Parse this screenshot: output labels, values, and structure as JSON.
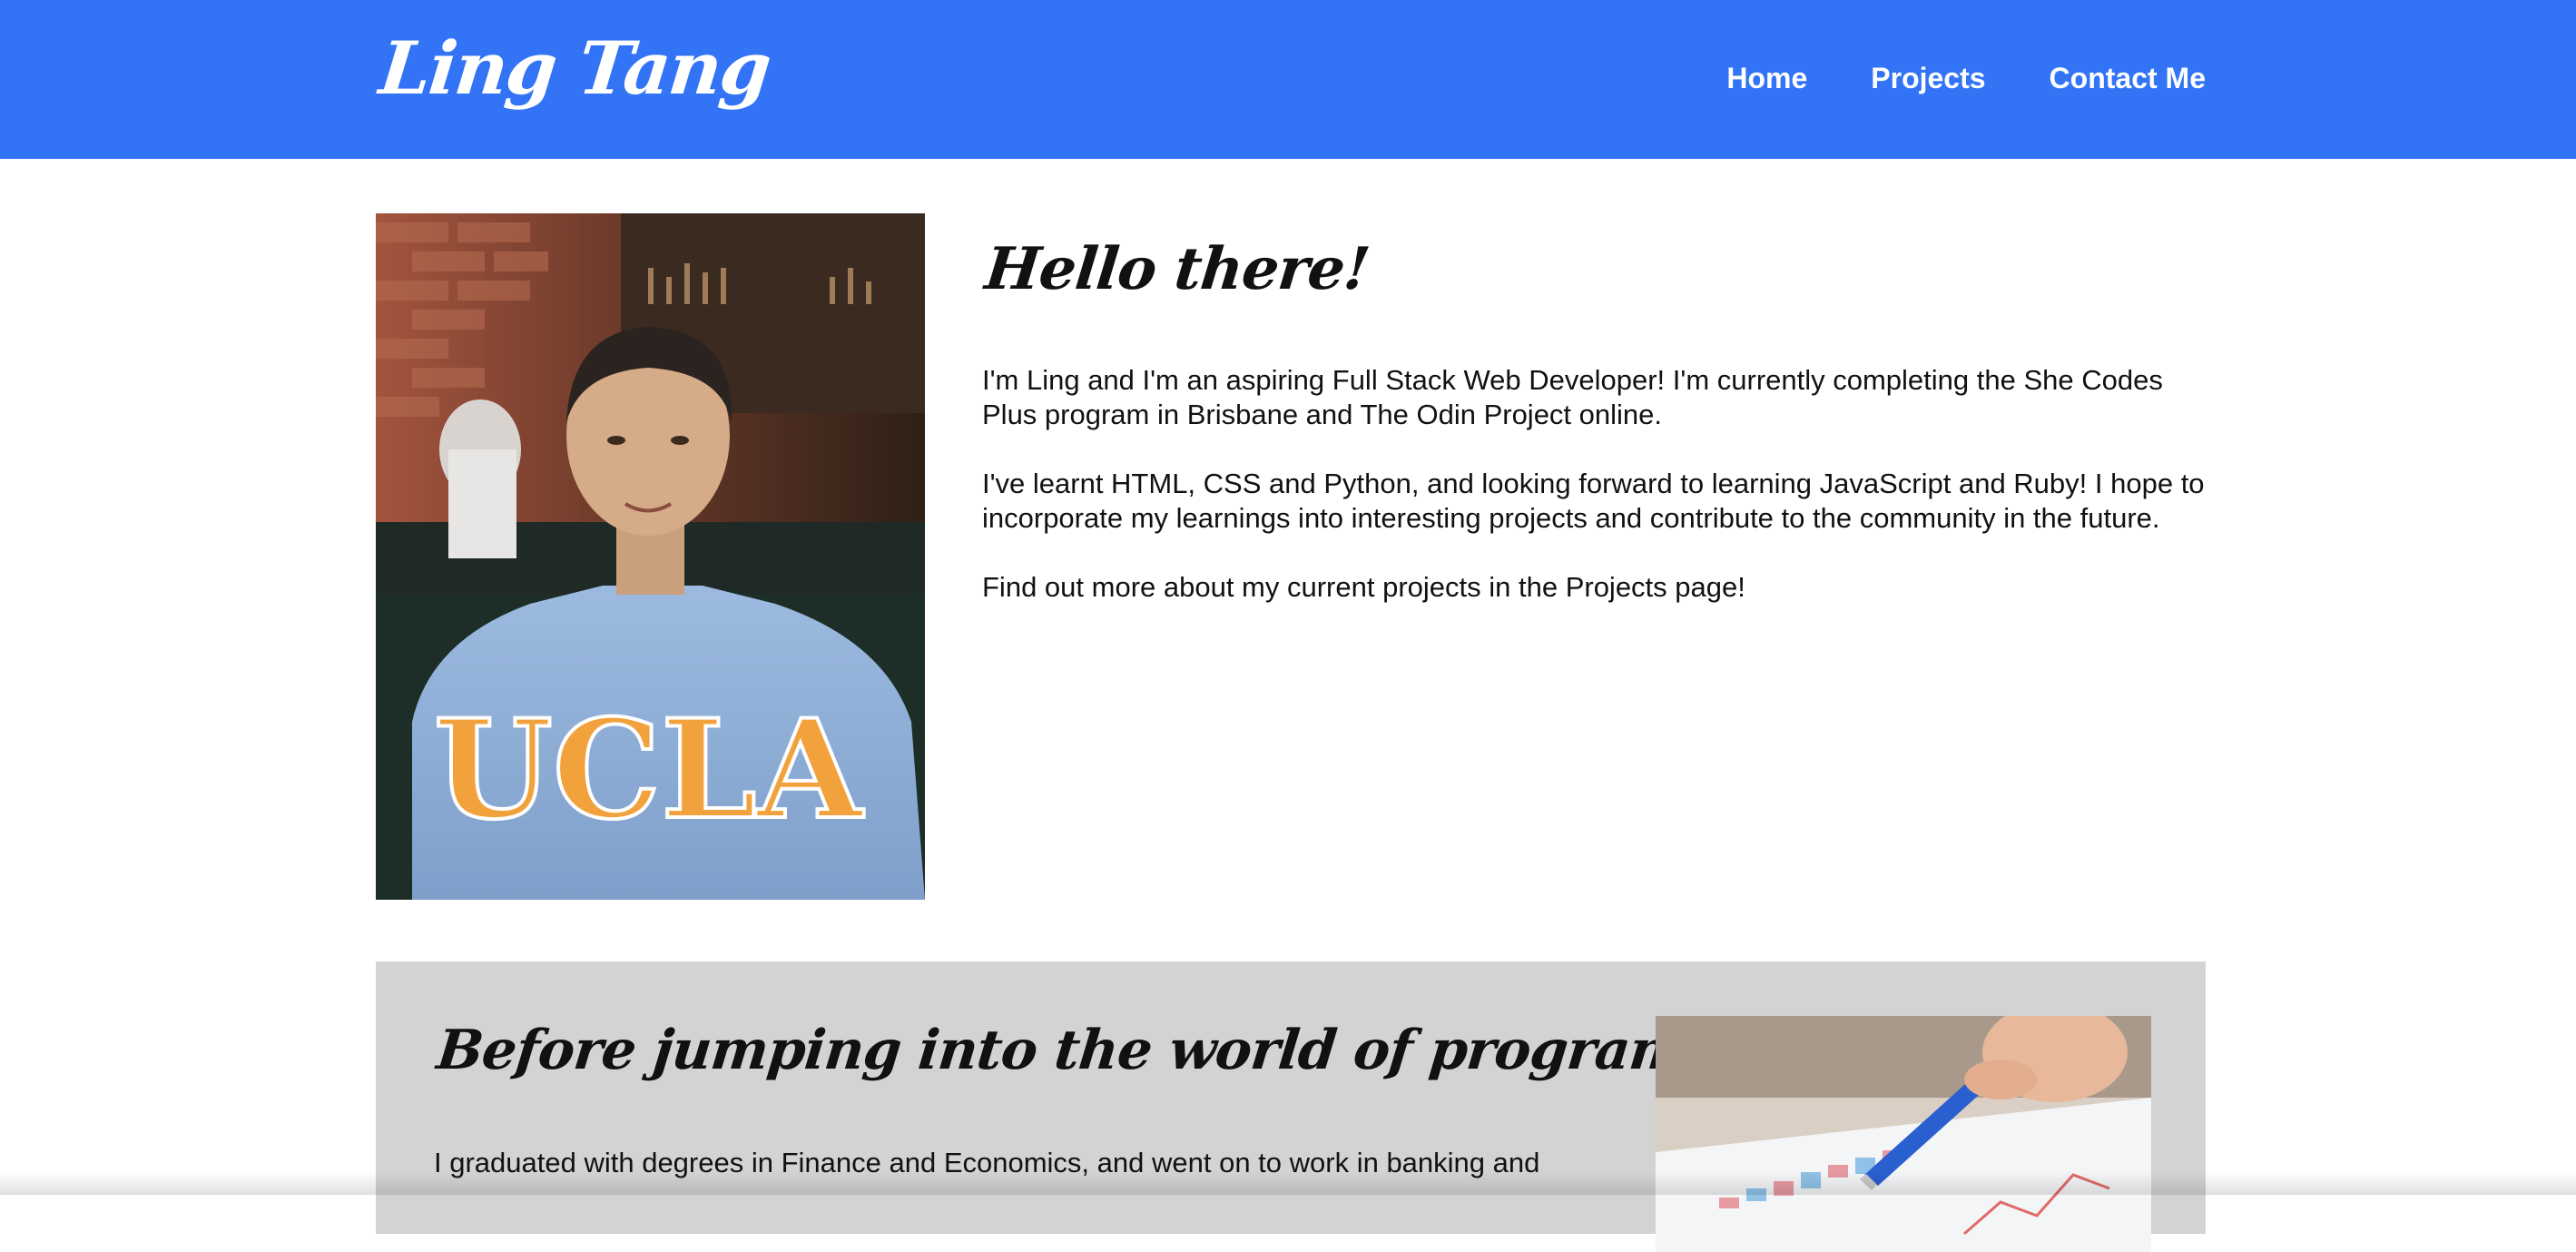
{
  "header": {
    "brand": "Ling Tang",
    "nav": [
      "Home",
      "Projects",
      "Contact Me"
    ]
  },
  "intro": {
    "heading": "Hello there!",
    "paragraphs": [
      "I'm Ling and I'm an aspiring Full Stack Web Developer! I'm currently completing the She Codes Plus program in Brisbane and The Odin Project online.",
      "I've learnt HTML, CSS and Python, and looking forward to learning JavaScript and Ruby! I hope to incorporate my learnings into interesting projects and contribute to the community in the future.",
      "Find out more about my current projects in the Projects page!"
    ],
    "photo_shirt_text": "UCLA"
  },
  "background_section": {
    "heading": "Before jumping into the world of programming...",
    "text": "I graduated with degrees in Finance and Economics, and went on to work in banking and"
  },
  "colors": {
    "navbar": "#3274f5",
    "section_gray": "#d3d3d3",
    "text": "#111111"
  }
}
